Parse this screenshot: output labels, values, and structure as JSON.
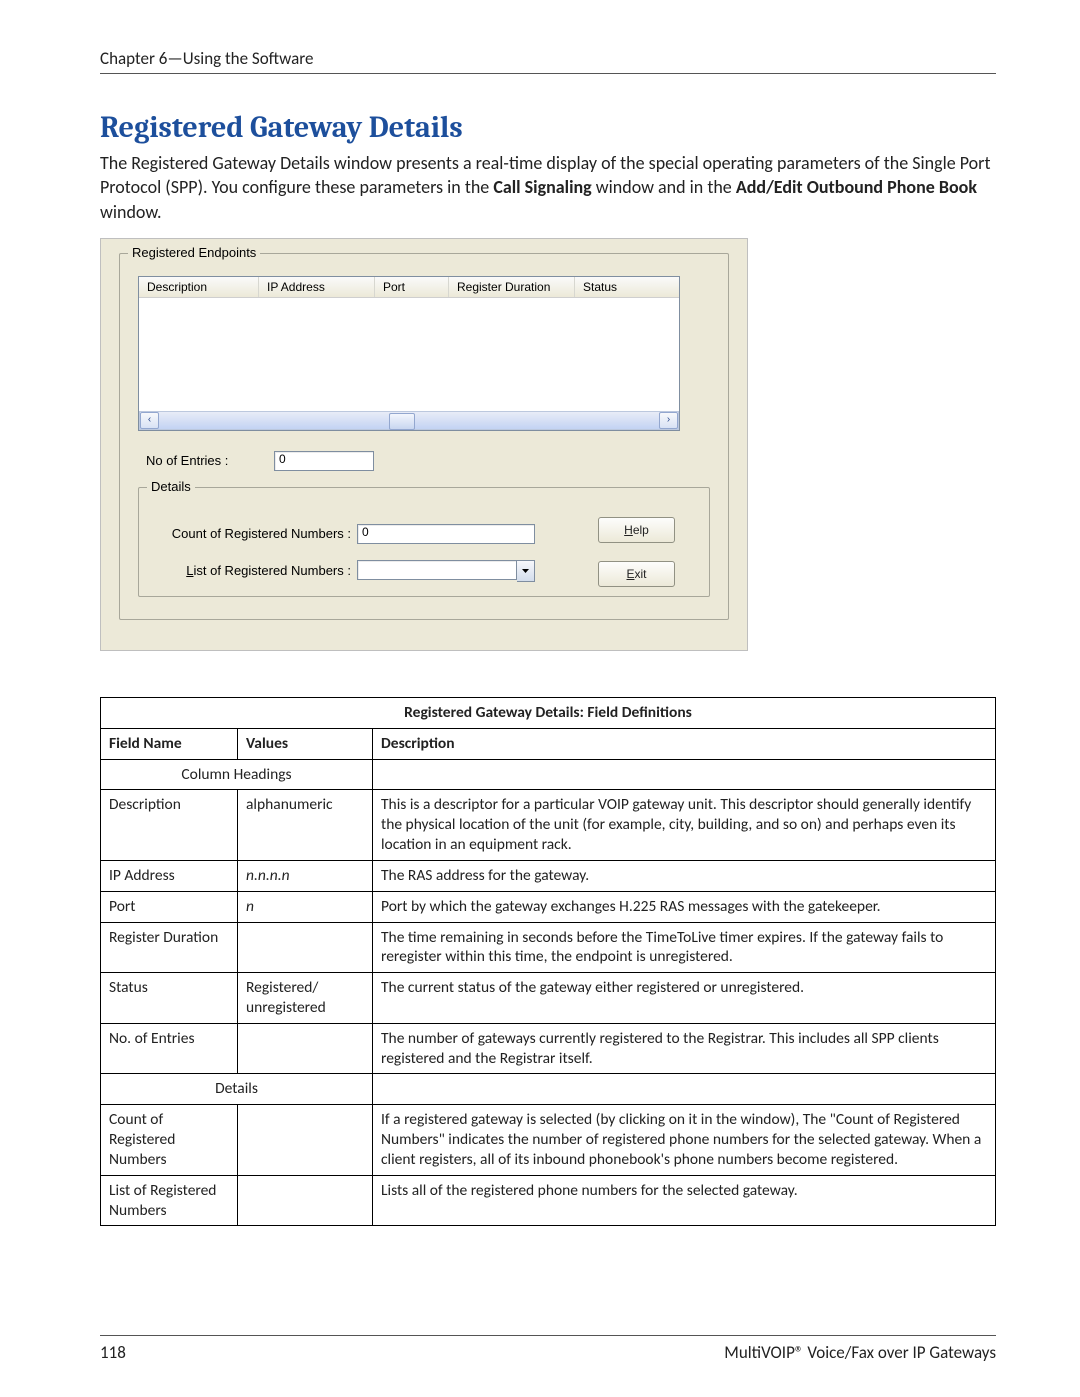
{
  "header": {
    "chapter": "Chapter 6—Using the Software"
  },
  "title": "Registered Gateway Details",
  "intro": {
    "pre": "The Registered Gateway Details window presents a real-time display of the special operating parameters of the Single Port Protocol (SPP). You configure these parameters in the ",
    "bold1": "Call Signaling",
    "mid": " window and in the ",
    "bold2": "Add/Edit Outbound Phone Book",
    "post": " window."
  },
  "screenshot": {
    "group_endpoints": "Registered Endpoints",
    "cols": {
      "description": "Description",
      "ip": "IP Address",
      "port": "Port",
      "regdur": "Register Duration",
      "status": "Status"
    },
    "no_entries_label": "No of Entries :",
    "no_entries_value": "0",
    "group_details": "Details",
    "count_label": "Count of Registered Numbers :",
    "count_value": "0",
    "list_label_pre": "L",
    "list_label_post": "ist of Registered Numbers :",
    "help_pre": "H",
    "help_post": "elp",
    "exit_pre": "E",
    "exit_post": "xit",
    "scroll_left": "‹",
    "scroll_right": "›"
  },
  "table": {
    "caption": "Registered Gateway Details: Field Definitions",
    "head": {
      "field": "Field Name",
      "values": "Values",
      "desc": "Description"
    },
    "section_columns": "Column Headings",
    "rows": {
      "description": {
        "field": "Description",
        "values": "alphanumeric",
        "desc": "This is a descriptor for a particular VOIP gateway unit. This descriptor should generally identify the physical location of the unit (for example, city, building, and so on) and perhaps even its location in an equipment rack."
      },
      "ip": {
        "field": "IP Address",
        "values": "n.n.n.n",
        "desc": "The RAS address for the gateway."
      },
      "port": {
        "field": "Port",
        "values": "n",
        "desc": "Port by which the gateway exchanges H.225 RAS messages with the gatekeeper."
      },
      "regdur": {
        "field": "Register Duration",
        "values": "",
        "desc": "The time remaining in seconds before the TimeToLive timer expires. If the gateway fails to reregister within this time, the endpoint is unregistered."
      },
      "status": {
        "field": "Status",
        "values": "Registered/ unregistered",
        "desc": "The current status of the gateway either registered or unregistered."
      },
      "noentries": {
        "field": "No. of Entries",
        "values": "",
        "desc": "The number of gateways currently registered to the Registrar. This includes all SPP clients registered and the Registrar itself."
      }
    },
    "section_details": "Details",
    "rows2": {
      "count": {
        "field": "Count of Registered Numbers",
        "values": "",
        "desc": "If a registered gateway is selected (by clicking on it in the window), The \"Count of Registered Numbers\" indicates the number of registered phone numbers for the selected gateway. When a client registers, all of its inbound phonebook's phone numbers become registered."
      },
      "list": {
        "field": "List of Registered Numbers",
        "values": "",
        "desc": "Lists all of the registered phone numbers for the selected gateway."
      }
    }
  },
  "footer": {
    "page": "118",
    "product": "MultiVOIP® Voice/Fax over IP Gateways"
  }
}
